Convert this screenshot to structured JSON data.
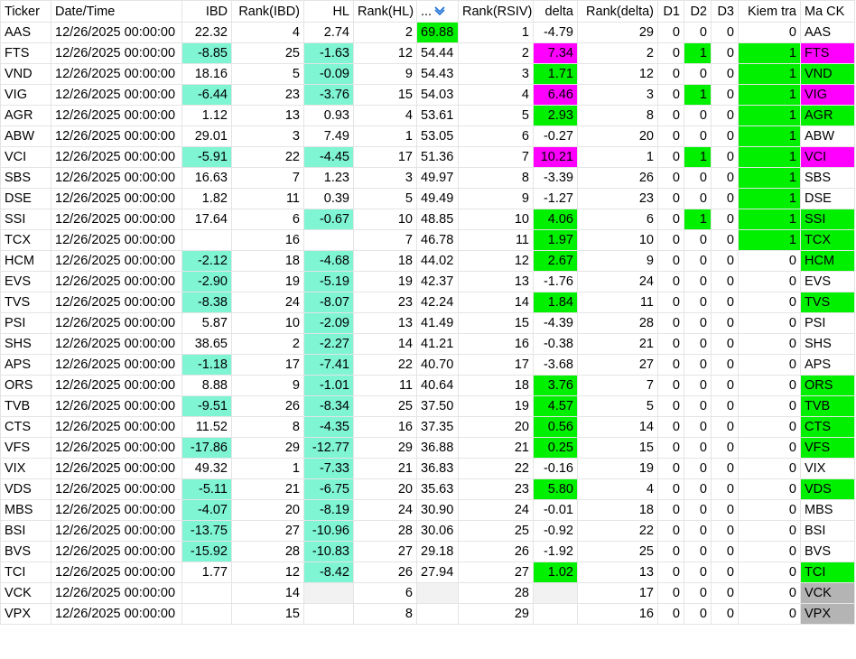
{
  "columns": [
    {
      "label": "Ticker",
      "align": "txt",
      "width": 56
    },
    {
      "label": "Date/Time",
      "align": "txt",
      "width": 145
    },
    {
      "label": "IBD",
      "align": "num",
      "width": 55
    },
    {
      "label": "Rank(IBD)",
      "align": "num",
      "width": 80
    },
    {
      "label": "HL",
      "align": "num",
      "width": 55
    },
    {
      "label": "Rank(HL)",
      "align": "num",
      "width": 70
    },
    {
      "label": "...",
      "align": "txt",
      "width": 46,
      "sort": true
    },
    {
      "label": "Rank(RSIV)",
      "align": "num",
      "width": 83
    },
    {
      "label": "delta",
      "align": "num",
      "width": 49
    },
    {
      "label": "Rank(delta)",
      "align": "num",
      "width": 89
    },
    {
      "label": "D1",
      "align": "num",
      "width": 29
    },
    {
      "label": "D2",
      "align": "num",
      "width": 30
    },
    {
      "label": "D3",
      "align": "num",
      "width": 30
    },
    {
      "label": "Kiem tra",
      "align": "num",
      "width": 69
    },
    {
      "label": "Ma CK",
      "align": "txt",
      "width": 60
    }
  ],
  "colors": {
    "teal": "#7ff5d4",
    "green": "#00f000",
    "magenta": "#ff00ff",
    "gray": "#b4b4b4"
  },
  "rows": [
    {
      "c": [
        "AAS",
        "12/26/2025 00:00:00",
        "22.32",
        "4",
        "2.74",
        "2",
        "69.88",
        "1",
        "-4.79",
        "29",
        "0",
        "0",
        "0",
        "0",
        "AAS"
      ],
      "h": {
        "6": "green"
      }
    },
    {
      "c": [
        "FTS",
        "12/26/2025 00:00:00",
        "-8.85",
        "25",
        "-1.63",
        "12",
        "54.44",
        "2",
        "7.34",
        "2",
        "0",
        "1",
        "0",
        "1",
        "FTS"
      ],
      "h": {
        "2": "teal",
        "4": "teal",
        "8": "magenta",
        "11": "green",
        "13": "green",
        "14": "magenta"
      }
    },
    {
      "c": [
        "VND",
        "12/26/2025 00:00:00",
        "18.16",
        "5",
        "-0.09",
        "9",
        "54.43",
        "3",
        "1.71",
        "12",
        "0",
        "0",
        "0",
        "1",
        "VND"
      ],
      "h": {
        "4": "teal",
        "8": "green",
        "13": "green",
        "14": "green"
      }
    },
    {
      "c": [
        "VIG",
        "12/26/2025 00:00:00",
        "-6.44",
        "23",
        "-3.76",
        "15",
        "54.03",
        "4",
        "6.46",
        "3",
        "0",
        "1",
        "0",
        "1",
        "VIG"
      ],
      "h": {
        "2": "teal",
        "4": "teal",
        "8": "magenta",
        "11": "green",
        "13": "green",
        "14": "magenta"
      }
    },
    {
      "c": [
        "AGR",
        "12/26/2025 00:00:00",
        "1.12",
        "13",
        "0.93",
        "4",
        "53.61",
        "5",
        "2.93",
        "8",
        "0",
        "0",
        "0",
        "1",
        "AGR"
      ],
      "h": {
        "8": "green",
        "13": "green",
        "14": "green"
      }
    },
    {
      "c": [
        "ABW",
        "12/26/2025 00:00:00",
        "29.01",
        "3",
        "7.49",
        "1",
        "53.05",
        "6",
        "-0.27",
        "20",
        "0",
        "0",
        "0",
        "1",
        "ABW"
      ],
      "h": {
        "13": "green"
      }
    },
    {
      "c": [
        "VCI",
        "12/26/2025 00:00:00",
        "-5.91",
        "22",
        "-4.45",
        "17",
        "51.36",
        "7",
        "10.21",
        "1",
        "0",
        "1",
        "0",
        "1",
        "VCI"
      ],
      "h": {
        "2": "teal",
        "4": "teal",
        "8": "magenta",
        "11": "green",
        "13": "green",
        "14": "magenta"
      }
    },
    {
      "c": [
        "SBS",
        "12/26/2025 00:00:00",
        "16.63",
        "7",
        "1.23",
        "3",
        "49.97",
        "8",
        "-3.39",
        "26",
        "0",
        "0",
        "0",
        "1",
        "SBS"
      ],
      "h": {
        "13": "green"
      }
    },
    {
      "c": [
        "DSE",
        "12/26/2025 00:00:00",
        "1.82",
        "11",
        "0.39",
        "5",
        "49.49",
        "9",
        "-1.27",
        "23",
        "0",
        "0",
        "0",
        "1",
        "DSE"
      ],
      "h": {
        "13": "green"
      }
    },
    {
      "c": [
        "SSI",
        "12/26/2025 00:00:00",
        "17.64",
        "6",
        "-0.67",
        "10",
        "48.85",
        "10",
        "4.06",
        "6",
        "0",
        "1",
        "0",
        "1",
        "SSI"
      ],
      "h": {
        "4": "teal",
        "8": "green",
        "11": "green",
        "13": "green",
        "14": "green"
      }
    },
    {
      "c": [
        "TCX",
        "12/26/2025 00:00:00",
        "",
        "16",
        "",
        "7",
        "46.78",
        "11",
        "1.97",
        "10",
        "0",
        "0",
        "0",
        "1",
        "TCX"
      ],
      "h": {
        "8": "green",
        "13": "green",
        "14": "green"
      }
    },
    {
      "c": [
        "HCM",
        "12/26/2025 00:00:00",
        "-2.12",
        "18",
        "-4.68",
        "18",
        "44.02",
        "12",
        "2.67",
        "9",
        "0",
        "0",
        "0",
        "0",
        "HCM"
      ],
      "h": {
        "2": "teal",
        "4": "teal",
        "8": "green",
        "14": "green"
      }
    },
    {
      "c": [
        "EVS",
        "12/26/2025 00:00:00",
        "-2.90",
        "19",
        "-5.19",
        "19",
        "42.37",
        "13",
        "-1.76",
        "24",
        "0",
        "0",
        "0",
        "0",
        "EVS"
      ],
      "h": {
        "2": "teal",
        "4": "teal"
      }
    },
    {
      "c": [
        "TVS",
        "12/26/2025 00:00:00",
        "-8.38",
        "24",
        "-8.07",
        "23",
        "42.24",
        "14",
        "1.84",
        "11",
        "0",
        "0",
        "0",
        "0",
        "TVS"
      ],
      "h": {
        "2": "teal",
        "4": "teal",
        "8": "green",
        "14": "green"
      }
    },
    {
      "c": [
        "PSI",
        "12/26/2025 00:00:00",
        "5.87",
        "10",
        "-2.09",
        "13",
        "41.49",
        "15",
        "-4.39",
        "28",
        "0",
        "0",
        "0",
        "0",
        "PSI"
      ],
      "h": {
        "4": "teal"
      }
    },
    {
      "c": [
        "SHS",
        "12/26/2025 00:00:00",
        "38.65",
        "2",
        "-2.27",
        "14",
        "41.21",
        "16",
        "-0.38",
        "21",
        "0",
        "0",
        "0",
        "0",
        "SHS"
      ],
      "h": {
        "4": "teal"
      }
    },
    {
      "c": [
        "APS",
        "12/26/2025 00:00:00",
        "-1.18",
        "17",
        "-7.41",
        "22",
        "40.70",
        "17",
        "-3.68",
        "27",
        "0",
        "0",
        "0",
        "0",
        "APS"
      ],
      "h": {
        "2": "teal",
        "4": "teal"
      }
    },
    {
      "c": [
        "ORS",
        "12/26/2025 00:00:00",
        "8.88",
        "9",
        "-1.01",
        "11",
        "40.64",
        "18",
        "3.76",
        "7",
        "0",
        "0",
        "0",
        "0",
        "ORS"
      ],
      "h": {
        "4": "teal",
        "8": "green",
        "14": "green"
      }
    },
    {
      "c": [
        "TVB",
        "12/26/2025 00:00:00",
        "-9.51",
        "26",
        "-8.34",
        "25",
        "37.50",
        "19",
        "4.57",
        "5",
        "0",
        "0",
        "0",
        "0",
        "TVB"
      ],
      "h": {
        "2": "teal",
        "4": "teal",
        "8": "green",
        "14": "green"
      }
    },
    {
      "c": [
        "CTS",
        "12/26/2025 00:00:00",
        "11.52",
        "8",
        "-4.35",
        "16",
        "37.35",
        "20",
        "0.56",
        "14",
        "0",
        "0",
        "0",
        "0",
        "CTS"
      ],
      "h": {
        "4": "teal",
        "8": "green",
        "14": "green"
      }
    },
    {
      "c": [
        "VFS",
        "12/26/2025 00:00:00",
        "-17.86",
        "29",
        "-12.77",
        "29",
        "36.88",
        "21",
        "0.25",
        "15",
        "0",
        "0",
        "0",
        "0",
        "VFS"
      ],
      "h": {
        "2": "teal",
        "4": "teal",
        "8": "green",
        "14": "green"
      }
    },
    {
      "c": [
        "VIX",
        "12/26/2025 00:00:00",
        "49.32",
        "1",
        "-7.33",
        "21",
        "36.83",
        "22",
        "-0.16",
        "19",
        "0",
        "0",
        "0",
        "0",
        "VIX"
      ],
      "h": {
        "4": "teal"
      }
    },
    {
      "c": [
        "VDS",
        "12/26/2025 00:00:00",
        "-5.11",
        "21",
        "-6.75",
        "20",
        "35.63",
        "23",
        "5.80",
        "4",
        "0",
        "0",
        "0",
        "0",
        "VDS"
      ],
      "h": {
        "2": "teal",
        "4": "teal",
        "8": "green",
        "14": "green"
      }
    },
    {
      "c": [
        "MBS",
        "12/26/2025 00:00:00",
        "-4.07",
        "20",
        "-8.19",
        "24",
        "30.90",
        "24",
        "-0.01",
        "18",
        "0",
        "0",
        "0",
        "0",
        "MBS"
      ],
      "h": {
        "2": "teal",
        "4": "teal"
      }
    },
    {
      "c": [
        "BSI",
        "12/26/2025 00:00:00",
        "-13.75",
        "27",
        "-10.96",
        "28",
        "30.06",
        "25",
        "-0.92",
        "22",
        "0",
        "0",
        "0",
        "0",
        "BSI"
      ],
      "h": {
        "2": "teal",
        "4": "teal"
      }
    },
    {
      "c": [
        "BVS",
        "12/26/2025 00:00:00",
        "-15.92",
        "28",
        "-10.83",
        "27",
        "29.18",
        "26",
        "-1.92",
        "25",
        "0",
        "0",
        "0",
        "0",
        "BVS"
      ],
      "h": {
        "2": "teal",
        "4": "teal"
      }
    },
    {
      "c": [
        "TCI",
        "12/26/2025 00:00:00",
        "1.77",
        "12",
        "-8.42",
        "26",
        "27.94",
        "27",
        "1.02",
        "13",
        "0",
        "0",
        "0",
        "0",
        "TCI"
      ],
      "h": {
        "4": "teal",
        "8": "green",
        "14": "green"
      }
    },
    {
      "c": [
        "VCK",
        "12/26/2025 00:00:00",
        "",
        "14",
        "",
        "6",
        "",
        "28",
        "",
        "17",
        "0",
        "0",
        "0",
        "0",
        "VCK"
      ],
      "h": {
        "4": "row",
        "6": "row",
        "8": "row",
        "14": "gray"
      }
    },
    {
      "c": [
        "VPX",
        "12/26/2025 00:00:00",
        "",
        "15",
        "",
        "8",
        "",
        "29",
        "",
        "16",
        "0",
        "0",
        "0",
        "0",
        "VPX"
      ],
      "h": {
        "14": "gray"
      }
    }
  ]
}
